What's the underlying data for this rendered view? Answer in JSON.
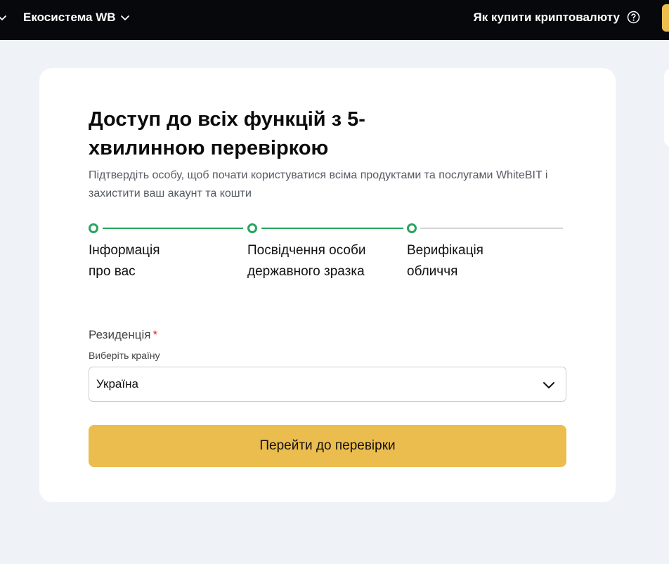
{
  "header": {
    "ecosystem_label": "Екосистема WB",
    "how_to_buy_label": "Як купити криптовалюту",
    "background": "#07080b"
  },
  "verification": {
    "title": "Доступ до всіх функцій з 5-хвилинною перевіркою",
    "subtitle": "Підтвердіть особу, щоб почати користуватися всіма продуктами та послугами WhiteBIT і захистити ваш акаунт та кошти",
    "steps": [
      {
        "label": "Інформація про вас"
      },
      {
        "label": "Посвідчення особи державного зразка"
      },
      {
        "label": "Верифікація обличчя"
      }
    ],
    "residency": {
      "label": "Резиденція",
      "required_mark": "*",
      "hint": "Виберіть країну",
      "selected": "Україна"
    },
    "submit_label": "Перейти до перевірки"
  },
  "colors": {
    "accent": "#ebbd4e",
    "step_done": "#28a55f",
    "step_pending": "#d4d6da",
    "required": "#d32f2f",
    "page_bg": "#eff2f7"
  },
  "icons": {
    "ecosystem": "chevron-down-icon",
    "help": "question-circle-icon",
    "select": "chevron-down-icon"
  }
}
